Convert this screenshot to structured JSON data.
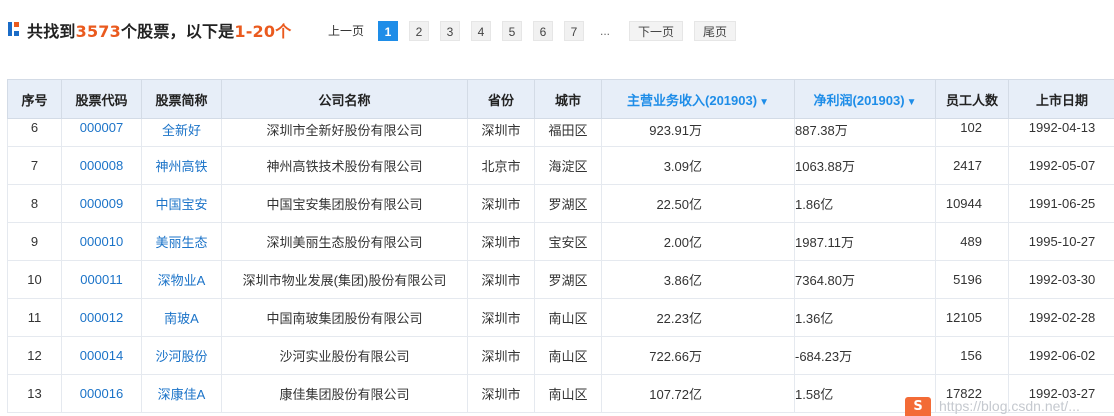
{
  "header": {
    "title_prefix": "共找到",
    "count": "3573",
    "title_mid": "个股票，以下是",
    "range": "1-20个"
  },
  "pager": {
    "prev": "上一页",
    "pages": [
      "1",
      "2",
      "3",
      "4",
      "5",
      "6",
      "7"
    ],
    "active_page": "1",
    "ellipsis": "...",
    "next": "下一页",
    "last": "尾页"
  },
  "table": {
    "columns": {
      "index": "序号",
      "code": "股票代码",
      "name": "股票简称",
      "company": "公司名称",
      "province": "省份",
      "city": "城市",
      "revenue": "主营业务收入(201903)",
      "profit": "净利润(201903)",
      "employees": "员工人数",
      "listing_date": "上市日期"
    },
    "sort_arrow": "▼",
    "rows": [
      {
        "index": "6",
        "code": "000007",
        "name": "全新好",
        "company": "深圳市全新好股份有限公司",
        "province": "深圳市",
        "city": "福田区",
        "revenue": "923.91万",
        "profit": "887.38万",
        "employees": "102",
        "listing_date": "1992-04-13"
      },
      {
        "index": "7",
        "code": "000008",
        "name": "神州高铁",
        "company": "神州高铁技术股份有限公司",
        "province": "北京市",
        "city": "海淀区",
        "revenue": "3.09亿",
        "profit": "1063.88万",
        "employees": "2417",
        "listing_date": "1992-05-07"
      },
      {
        "index": "8",
        "code": "000009",
        "name": "中国宝安",
        "company": "中国宝安集团股份有限公司",
        "province": "深圳市",
        "city": "罗湖区",
        "revenue": "22.50亿",
        "profit": "1.86亿",
        "employees": "10944",
        "listing_date": "1991-06-25"
      },
      {
        "index": "9",
        "code": "000010",
        "name": "美丽生态",
        "company": "深圳美丽生态股份有限公司",
        "province": "深圳市",
        "city": "宝安区",
        "revenue": "2.00亿",
        "profit": "1987.11万",
        "employees": "489",
        "listing_date": "1995-10-27"
      },
      {
        "index": "10",
        "code": "000011",
        "name": "深物业A",
        "company": "深圳市物业发展(集团)股份有限公司",
        "province": "深圳市",
        "city": "罗湖区",
        "revenue": "3.86亿",
        "profit": "7364.80万",
        "employees": "5196",
        "listing_date": "1992-03-30"
      },
      {
        "index": "11",
        "code": "000012",
        "name": "南玻A",
        "company": "中国南玻集团股份有限公司",
        "province": "深圳市",
        "city": "南山区",
        "revenue": "22.23亿",
        "profit": "1.36亿",
        "employees": "12105",
        "listing_date": "1992-02-28"
      },
      {
        "index": "12",
        "code": "000014",
        "name": "沙河股份",
        "company": "沙河实业股份有限公司",
        "province": "深圳市",
        "city": "南山区",
        "revenue": "722.66万",
        "profit": "-684.23万",
        "employees": "156",
        "listing_date": "1992-06-02"
      },
      {
        "index": "13",
        "code": "000016",
        "name": "深康佳A",
        "company": "康佳集团股份有限公司",
        "province": "深圳市",
        "city": "南山区",
        "revenue": "107.72亿",
        "profit": "1.58亿",
        "employees": "17822",
        "listing_date": "1992-03-27"
      }
    ]
  },
  "watermark": {
    "logo": "S",
    "text": "https://blog.csdn.net/..."
  }
}
